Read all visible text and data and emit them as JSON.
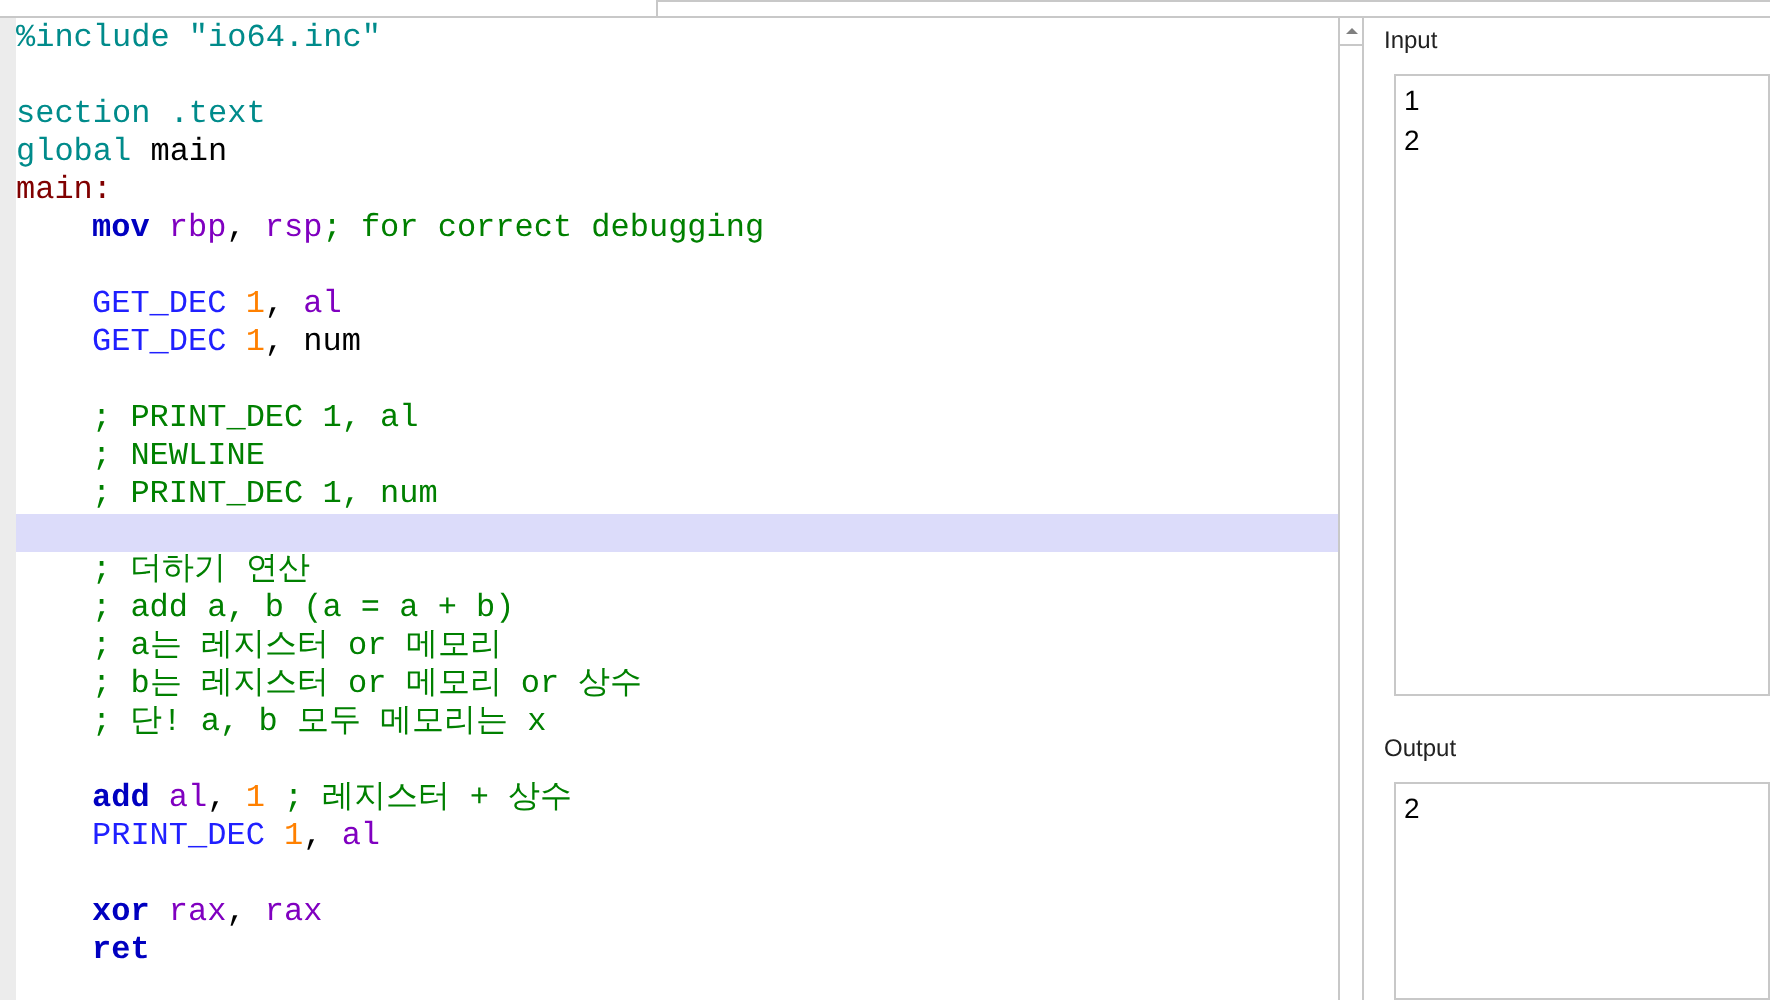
{
  "editor": {
    "lines": [
      {
        "kind": "code",
        "current": false,
        "indented": false,
        "tokens": [
          {
            "text": "%include \"io64.inc\"",
            "kind": "directive"
          }
        ]
      },
      {
        "kind": "blank",
        "current": false
      },
      {
        "kind": "code",
        "current": false,
        "indented": false,
        "tokens": [
          {
            "text": "section .text",
            "kind": "directive"
          }
        ]
      },
      {
        "kind": "code",
        "current": false,
        "indented": false,
        "tokens": [
          {
            "text": "global",
            "kind": "directive"
          },
          {
            "text": " main",
            "kind": "plain"
          }
        ]
      },
      {
        "kind": "code",
        "current": false,
        "indented": false,
        "tokens": [
          {
            "text": "main:",
            "kind": "label"
          }
        ]
      },
      {
        "kind": "code",
        "current": false,
        "indented": true,
        "tokens": [
          {
            "text": "mov",
            "kind": "keyword"
          },
          {
            "text": " rbp",
            "kind": "register"
          },
          {
            "text": ", ",
            "kind": "plain"
          },
          {
            "text": "rsp",
            "kind": "register"
          },
          {
            "text": "; for correct debugging",
            "kind": "comment"
          }
        ]
      },
      {
        "kind": "blank",
        "current": false
      },
      {
        "kind": "code",
        "current": false,
        "indented": true,
        "tokens": [
          {
            "text": "GET_DEC",
            "kind": "macro"
          },
          {
            "text": " 1",
            "kind": "number"
          },
          {
            "text": ", ",
            "kind": "plain"
          },
          {
            "text": "al",
            "kind": "register"
          }
        ]
      },
      {
        "kind": "code",
        "current": false,
        "indented": true,
        "tokens": [
          {
            "text": "GET_DEC",
            "kind": "macro"
          },
          {
            "text": " 1",
            "kind": "number"
          },
          {
            "text": ", num",
            "kind": "plain"
          }
        ]
      },
      {
        "kind": "blank",
        "current": false
      },
      {
        "kind": "code",
        "current": false,
        "indented": true,
        "tokens": [
          {
            "text": "; PRINT_DEC 1, al",
            "kind": "comment"
          }
        ]
      },
      {
        "kind": "code",
        "current": false,
        "indented": true,
        "tokens": [
          {
            "text": "; NEWLINE",
            "kind": "comment"
          }
        ]
      },
      {
        "kind": "code",
        "current": false,
        "indented": true,
        "tokens": [
          {
            "text": "; PRINT_DEC 1, num",
            "kind": "comment"
          }
        ]
      },
      {
        "kind": "blank",
        "current": true
      },
      {
        "kind": "code",
        "current": false,
        "indented": true,
        "tokens": [
          {
            "text": "; 더하기 연산",
            "kind": "comment"
          }
        ]
      },
      {
        "kind": "code",
        "current": false,
        "indented": true,
        "tokens": [
          {
            "text": "; add a, b (a = a + b)",
            "kind": "comment"
          }
        ]
      },
      {
        "kind": "code",
        "current": false,
        "indented": true,
        "tokens": [
          {
            "text": "; a는 레지스터 or 메모리",
            "kind": "comment"
          }
        ]
      },
      {
        "kind": "code",
        "current": false,
        "indented": true,
        "tokens": [
          {
            "text": "; b는 레지스터 or 메모리 or 상수",
            "kind": "comment"
          }
        ]
      },
      {
        "kind": "code",
        "current": false,
        "indented": true,
        "tokens": [
          {
            "text": "; 단! a, b 모두 메모리는 x",
            "kind": "comment"
          }
        ]
      },
      {
        "kind": "blank",
        "current": false
      },
      {
        "kind": "code",
        "current": false,
        "indented": true,
        "tokens": [
          {
            "text": "add",
            "kind": "keyword"
          },
          {
            "text": " al",
            "kind": "register"
          },
          {
            "text": ", ",
            "kind": "plain"
          },
          {
            "text": "1",
            "kind": "number"
          },
          {
            "text": " ; 레지스터 + 상수",
            "kind": "comment"
          }
        ]
      },
      {
        "kind": "code",
        "current": false,
        "indented": true,
        "tokens": [
          {
            "text": "PRINT_DEC",
            "kind": "macro"
          },
          {
            "text": " 1",
            "kind": "number"
          },
          {
            "text": ", ",
            "kind": "plain"
          },
          {
            "text": "al",
            "kind": "register"
          }
        ]
      },
      {
        "kind": "blank",
        "current": false
      },
      {
        "kind": "code",
        "current": false,
        "indented": true,
        "tokens": [
          {
            "text": "xor",
            "kind": "keyword"
          },
          {
            "text": " rax",
            "kind": "register"
          },
          {
            "text": ", ",
            "kind": "plain"
          },
          {
            "text": "rax",
            "kind": "register"
          }
        ]
      },
      {
        "kind": "code",
        "current": false,
        "indented": true,
        "tokens": [
          {
            "text": "ret",
            "kind": "keyword"
          }
        ]
      }
    ]
  },
  "input": {
    "label": "Input",
    "value": "1\n2"
  },
  "output": {
    "label": "Output",
    "value": "2"
  }
}
